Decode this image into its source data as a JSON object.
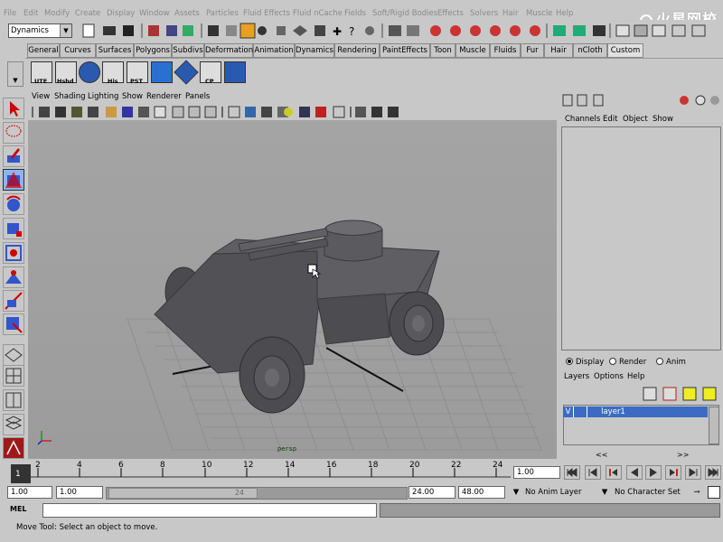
{
  "menubar": [
    "File",
    "Edit",
    "Modify",
    "Create",
    "Display",
    "Window",
    "Assets",
    "Particles",
    "Fluid Effects",
    "Fluid nCache",
    "Fields",
    "Soft/Rigid Bodies",
    "Effects",
    "Solvers",
    "Hair",
    "Muscle",
    "Help"
  ],
  "watermark": "火星网校",
  "statusline": {
    "mode": "Dynamics"
  },
  "shelf_tabs": [
    "General",
    "Curves",
    "Surfaces",
    "Polygons",
    "Subdivs",
    "Deformation",
    "Animation",
    "Dynamics",
    "Rendering",
    "PaintEffects",
    "Toon",
    "Muscle",
    "Fluids",
    "Fur",
    "Hair",
    "nCloth",
    "Custom"
  ],
  "shelf_active": "Custom",
  "shelf_buttons": [
    "UTE",
    "Hshd",
    "",
    "His",
    "PST",
    "",
    "CP",
    ""
  ],
  "viewport": {
    "menu": [
      "View",
      "Shading",
      "Lighting",
      "Show",
      "Renderer",
      "Panels"
    ],
    "camera_label": "persp"
  },
  "channel_box": {
    "menu": [
      "Channels",
      "Edit",
      "Object",
      "Show"
    ]
  },
  "layers": {
    "radios": [
      "Display",
      "Render",
      "Anim"
    ],
    "menu": [
      "Layers",
      "Options",
      "Help"
    ],
    "rows": [
      {
        "visible": "V",
        "name": "layer1"
      }
    ],
    "scroll": [
      "<<",
      ">>"
    ]
  },
  "timeline": {
    "ticks": [
      "2",
      "4",
      "6",
      "8",
      "10",
      "12",
      "14",
      "16",
      "18",
      "20",
      "22",
      "24"
    ],
    "current_frame": "1",
    "current_time": "1.00"
  },
  "range": {
    "start": "1.00",
    "playback_start": "1.00",
    "handle_label": "24",
    "playback_end": "24.00",
    "end": "48.00",
    "anim_layer": "No Anim Layer",
    "character_set": "No Character Set"
  },
  "command": {
    "label": "MEL"
  },
  "help_line": "Move Tool: Select an object to move."
}
